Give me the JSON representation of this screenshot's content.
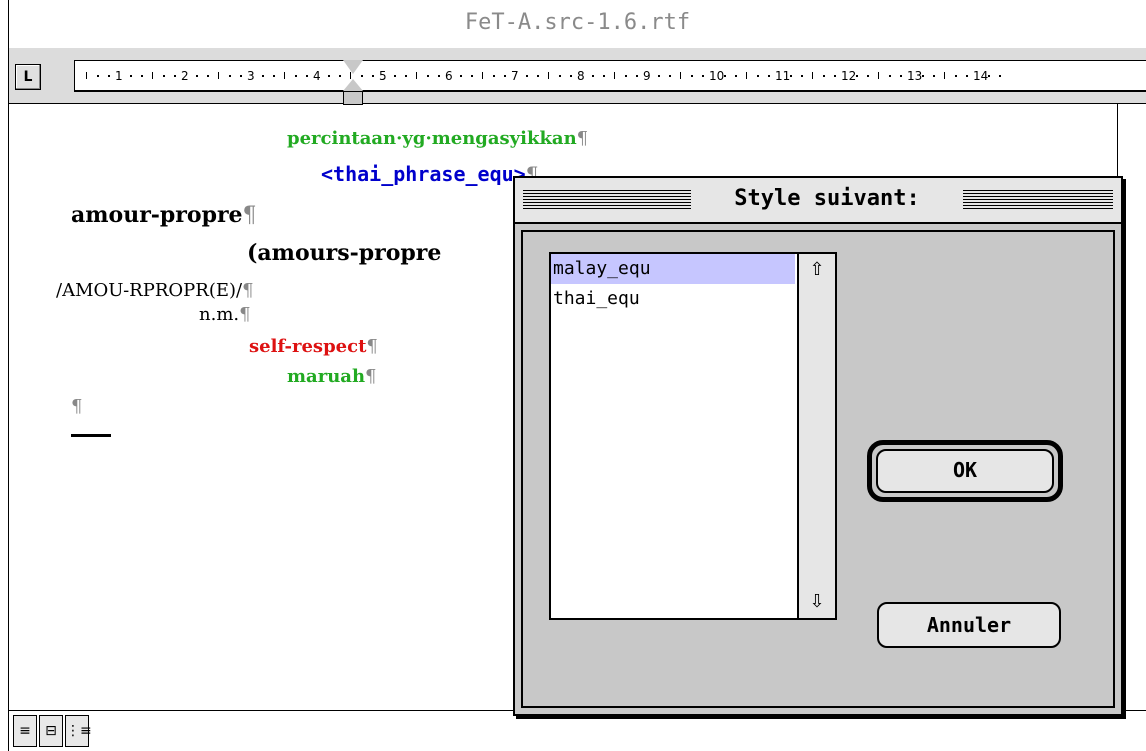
{
  "window": {
    "title": "FeT-A.src-1.6.rtf"
  },
  "ruler": {
    "tab_button": "L",
    "numbers": [
      "1",
      "2",
      "3",
      "4",
      "5",
      "6",
      "7",
      "8",
      "9",
      "10",
      "11",
      "12",
      "13",
      "14"
    ]
  },
  "document": {
    "lines": [
      {
        "text": "percintaan·yg·mengasyikkan",
        "style": "green"
      },
      {
        "text": "<thai_phrase_equ>",
        "style": "blue"
      },
      {
        "text": "amour-propre",
        "style": "black-bold"
      },
      {
        "text": "(amours-propre",
        "style": "black-bold"
      },
      {
        "text": "/AMOU-RPROPR(E)/",
        "style": "mono"
      },
      {
        "text": "n.m.",
        "style": "mono"
      },
      {
        "text": "self-respect",
        "style": "red"
      },
      {
        "text": "maruah",
        "style": "green"
      },
      {
        "text": "",
        "style": "mono"
      }
    ],
    "pilcrow": "¶"
  },
  "dialog": {
    "title": "Style suivant:",
    "list": {
      "items": [
        "malay_equ",
        "thai_equ"
      ],
      "selected": 0
    },
    "ok_label": "OK",
    "cancel_label": "Annuler"
  },
  "bottom_toolbar": {
    "buttons": [
      "≡",
      "⊟",
      "⋮≡"
    ]
  }
}
